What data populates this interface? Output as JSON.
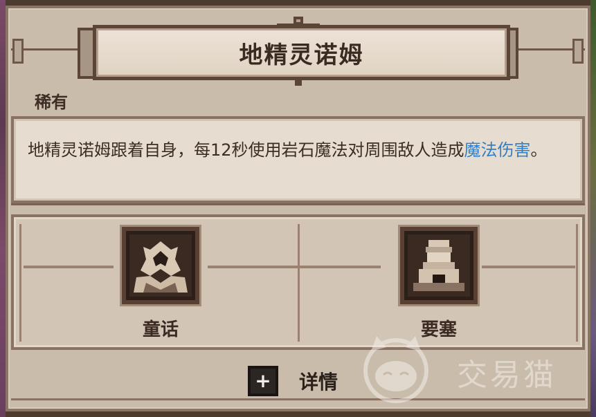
{
  "card": {
    "title": "地精灵诺姆",
    "rarity": "稀有",
    "description_prefix": "地精灵诺姆跟着自身，每12秒使用岩石魔法对周围敌人造成",
    "description_highlight": "魔法伤害",
    "description_suffix": "。",
    "highlight_color": "#2f7fcb"
  },
  "traits": [
    {
      "label": "童话",
      "icon": "goblin-mask-icon"
    },
    {
      "label": "要塞",
      "icon": "fortress-tower-icon"
    }
  ],
  "details_button": {
    "label": "详情",
    "icon": "plus-icon"
  },
  "watermark": {
    "text": "交易猫",
    "icon": "cat-logo-icon"
  }
}
